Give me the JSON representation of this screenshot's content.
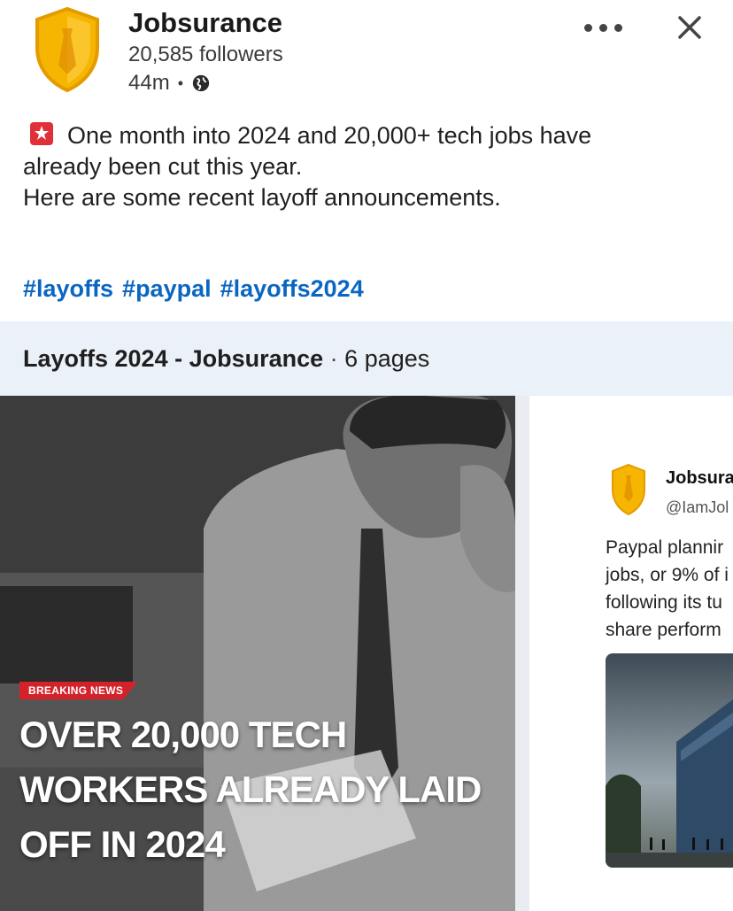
{
  "header": {
    "company_name": "Jobsurance",
    "followers": "20,585 followers",
    "time": "44m",
    "meta_dot": "•"
  },
  "post": {
    "lines": [
      "One month into 2024 and 20,000+ tech jobs have",
      "already been cut this year.",
      "Here are some recent layoff announcements."
    ],
    "hashtags": [
      "#layoffs",
      "#paypal",
      "#layoffs2024"
    ]
  },
  "document": {
    "title": "Layoffs 2024 - Jobsurance",
    "separator": "·",
    "pages": "6 pages"
  },
  "slide1": {
    "badge": "BREAKING NEWS",
    "headline_lines": [
      "OVER 20,000 TECH",
      "WORKERS ALREADY LAID",
      "OFF IN 2024"
    ]
  },
  "slide2": {
    "name": "Jobsura",
    "handle": "@IamJol",
    "text_lines": [
      "Paypal plannir",
      "jobs, or 9% of i",
      "following its tu",
      "share perform"
    ]
  },
  "colors": {
    "accent": "#0a66c2",
    "brand_shield": "#f5b800",
    "doc_bar_bg": "#eaf1f8",
    "breaking_red": "#d4222a"
  },
  "icons": [
    "shield-logo-icon",
    "globe-icon",
    "more-options-icon",
    "close-icon",
    "siren-icon"
  ]
}
